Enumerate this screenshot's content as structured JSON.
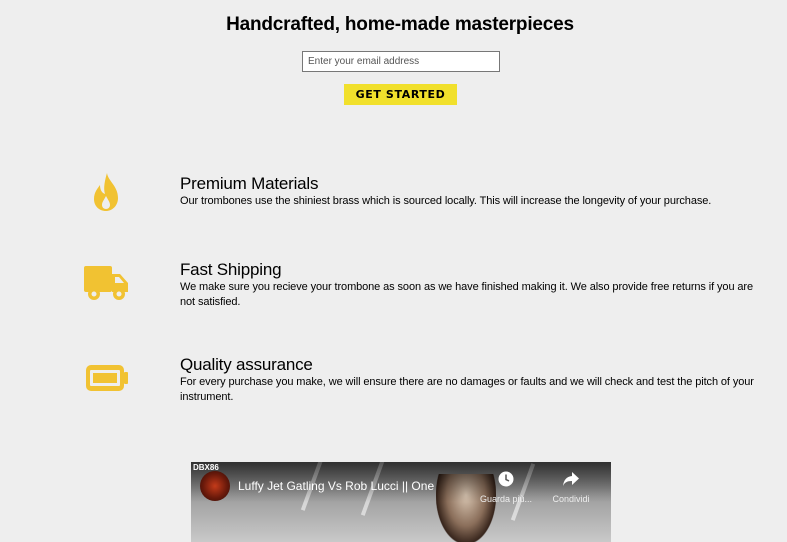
{
  "hero": {
    "title": "Handcrafted, home-made masterpieces",
    "email_placeholder": "Enter your email address",
    "cta_label": "GET STARTED"
  },
  "features": [
    {
      "icon": "fire-icon",
      "title": "Premium Materials",
      "description": "Our trombones use the shiniest brass which is sourced locally. This will increase the longevity of your purchase."
    },
    {
      "icon": "truck-icon",
      "title": "Fast Shipping",
      "description": "We make sure you recieve your trombone as soon as we have finished making it. We also provide free returns if you are not satisfied."
    },
    {
      "icon": "battery-icon",
      "title": "Quality assurance",
      "description": "For every purchase you make, we will ensure there are no damages or faults and we will check and test the pitch of your instrument."
    }
  ],
  "video": {
    "watermark": "DBX86",
    "title": "Luffy Jet Gatling Vs Rob Lucci || One",
    "watch_later_label": "Guarda più...",
    "share_label": "Condividi"
  },
  "colors": {
    "accent": "#f1c232",
    "button": "#f1e02c",
    "background": "#eeeeee"
  }
}
